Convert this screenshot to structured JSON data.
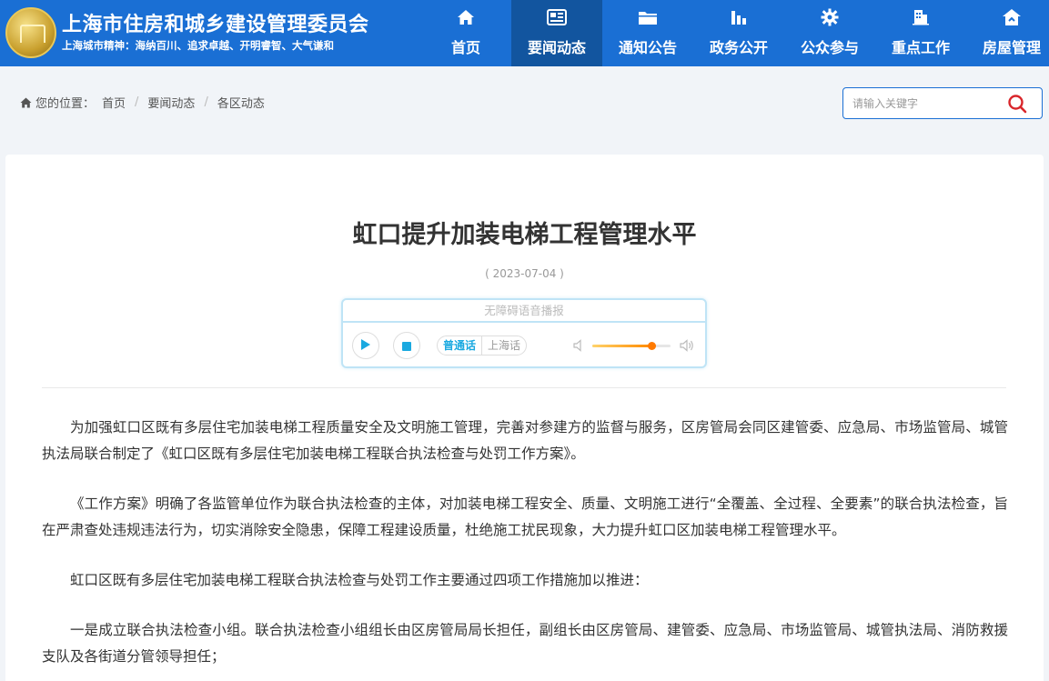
{
  "header": {
    "site_title": "上海市住房和城乡建设管理委员会",
    "motto": "上海城市精神：海纳百川、追求卓越、开明睿智、大气谦和",
    "nav": [
      {
        "label": "首页",
        "icon": "home-icon"
      },
      {
        "label": "要闻动态",
        "icon": "news-icon",
        "active": true
      },
      {
        "label": "通知公告",
        "icon": "folder-icon"
      },
      {
        "label": "政务公开",
        "icon": "bar-chart-icon"
      },
      {
        "label": "公众参与",
        "icon": "gear-icon"
      },
      {
        "label": "重点工作",
        "icon": "building-icon"
      },
      {
        "label": "房屋管理",
        "icon": "house-icon"
      }
    ],
    "colors": {
      "bar": "#1a6fd4",
      "active": "#12559f"
    }
  },
  "breadcrumb": {
    "prefix": "您的位置：",
    "items": [
      "首页",
      "要闻动态",
      "各区动态"
    ]
  },
  "search": {
    "placeholder": "请输入关键字"
  },
  "article": {
    "title": "虹口提升加装电梯工程管理水平",
    "date": "( 2023-07-04 )",
    "paragraphs": [
      "为加强虹口区既有多层住宅加装电梯工程质量安全及文明施工管理，完善对参建方的监督与服务，区房管局会同区建管委、应急局、市场监管局、城管执法局联合制定了《虹口区既有多层住宅加装电梯工程联合执法检查与处罚工作方案》。",
      "《工作方案》明确了各监管单位作为联合执法检查的主体，对加装电梯工程安全、质量、文明施工进行“全覆盖、全过程、全要素”的联合执法检查，旨在严肃查处违规违法行为，切实消除安全隐患，保障工程建设质量，杜绝施工扰民现象，大力提升虹口区加装电梯工程管理水平。",
      "虹口区既有多层住宅加装电梯工程联合执法检查与处罚工作主要通过四项工作措施加以推进：",
      "一是成立联合执法检查小组。联合执法检查小组组长由区房管局局长担任，副组长由区房管局、建管委、应急局、市场监管局、城管执法局、消防救援支队及各街道分管领导担任；"
    ]
  },
  "player": {
    "title": "无障碍语音播报",
    "lang_options": [
      "普通话",
      "上海话"
    ],
    "selected_lang": "普通话",
    "volume": 0.75,
    "accent": "#1aa9e0"
  }
}
